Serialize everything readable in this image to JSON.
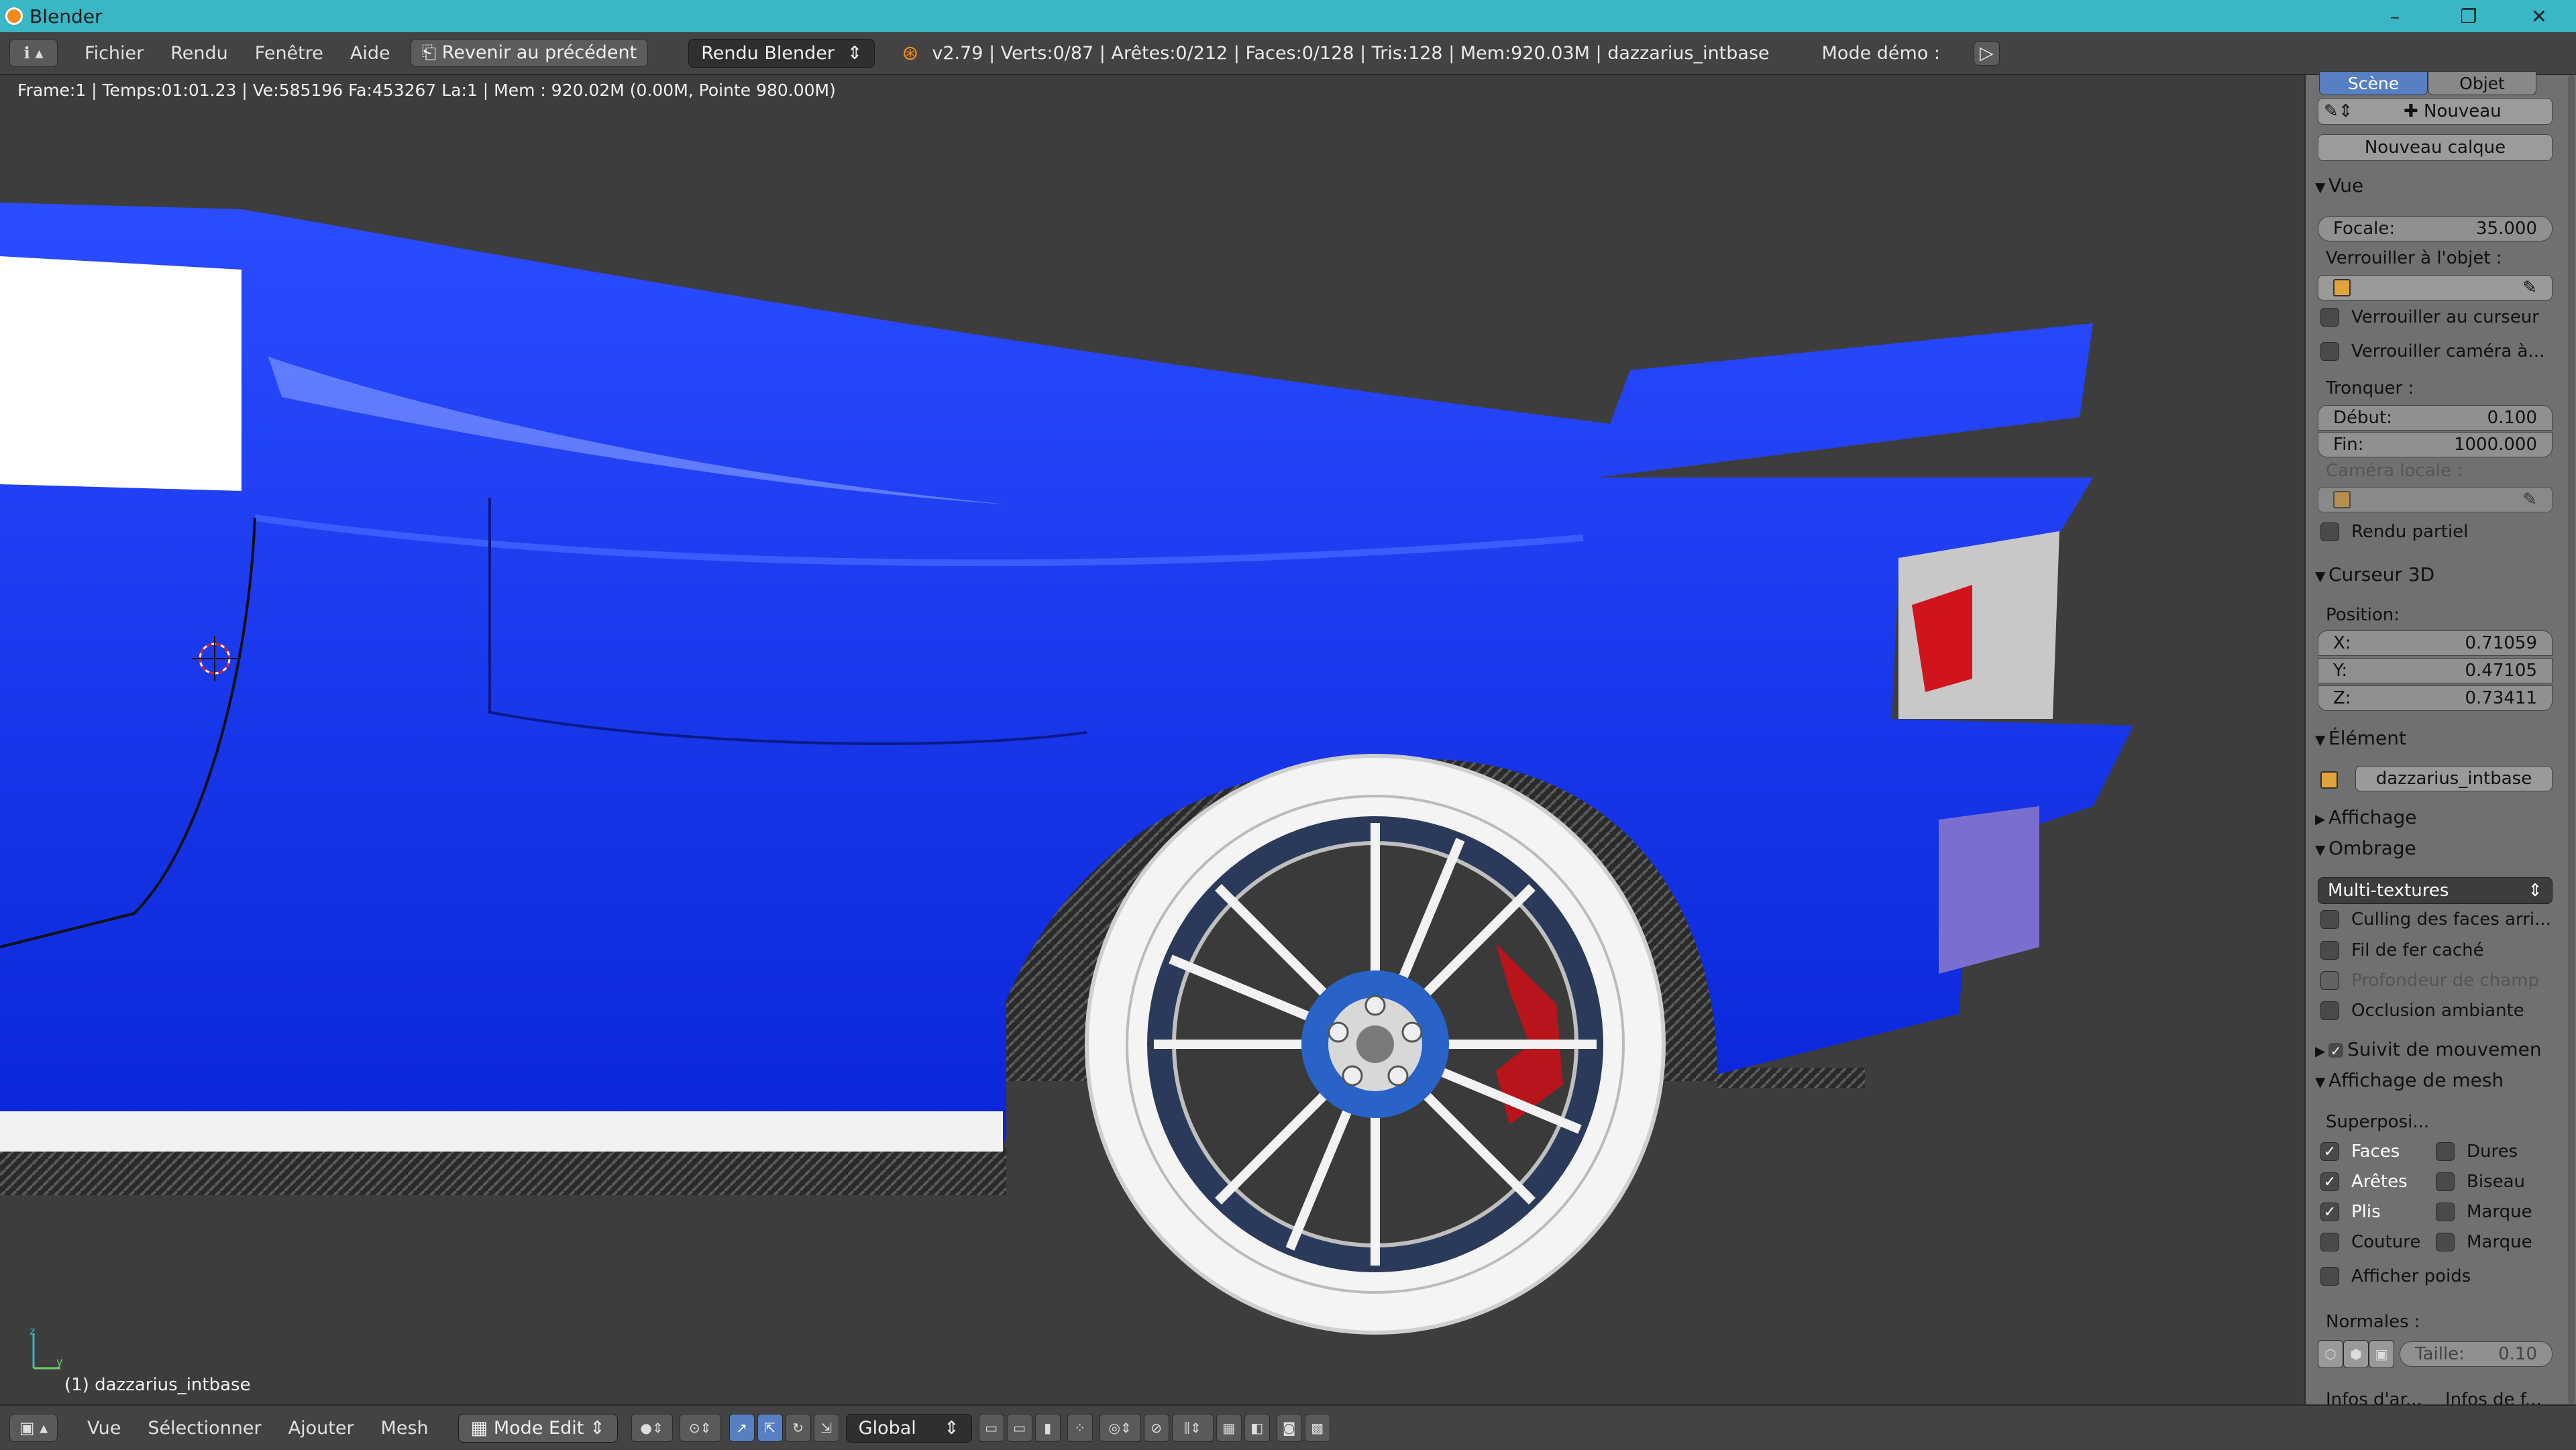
{
  "window": {
    "title": "Blender",
    "minimize": "–",
    "maximize": "❐",
    "close": "✕"
  },
  "topbar": {
    "editor_icon": "ℹ",
    "menus": [
      "Fichier",
      "Rendu",
      "Fenêtre",
      "Aide"
    ],
    "revert_button": "Revenir au précédent",
    "engine": "Rendu Blender",
    "stats": "v2.79 | Verts:0/87 | Arêtes:0/212 | Faces:0/128 | Tris:128 | Mem:920.03M | dazzarius_intbase",
    "demo_mode": "Mode démo :",
    "play_icon": "▷"
  },
  "viewport": {
    "info": "Frame:1 | Temps:01:01.23 | Ve:585196 Fa:453267 La:1 | Mem  : 920.02M (0.00M, Pointe 980.00M)",
    "object_label": "(1) dazzarius_intbase",
    "axis_z": "z",
    "axis_y": "y",
    "colors": {
      "body": "#0b2ff2",
      "tire": "#f4f4f4",
      "rim": "#dcdcdc",
      "caliper": "#b8141c",
      "carbon": "#2c2c2c"
    }
  },
  "panel": {
    "tabs": [
      "Scène",
      "Objet"
    ],
    "new_label": "Nouveau",
    "new_layer": "Nouveau calque",
    "vue": {
      "title": "Vue",
      "focale_label": "Focale:",
      "focale_value": "35.000",
      "lock_object_label": "Verrouiller à l'objet  :",
      "lock_cursor": "Verrouiller au curseur",
      "lock_camera": "Verrouiller caméra à...",
      "clip_label": "Tronquer  :",
      "start_label": "Début:",
      "start_value": "0.100",
      "end_label": "Fin:",
      "end_value": "1000.000",
      "local_camera": "Caméra locale  :",
      "partial_render": "Rendu partiel"
    },
    "cursor": {
      "title": "Curseur 3D",
      "position_label": "Position:",
      "x_label": "X:",
      "x_value": "0.71059",
      "y_label": "Y:",
      "y_value": "0.47105",
      "z_label": "Z:",
      "z_value": "0.73411"
    },
    "item": {
      "title": "Élément",
      "name": "dazzarius_intbase"
    },
    "display": {
      "title": "Affichage"
    },
    "shading": {
      "title": "Ombrage",
      "mode": "Multi-textures",
      "backface": "Culling des faces arri...",
      "hidden_wire": "Fil de fer caché",
      "dof": "Profondeur de champ",
      "ao": "Occlusion ambiante"
    },
    "motion_tracking": "Suivit de mouvemen",
    "mesh_display": {
      "title": "Affichage de mesh",
      "overlays": "Superposi...",
      "faces": "Faces",
      "edges": "Arêtes",
      "creases": "Plis",
      "seams": "Couture",
      "sharp": "Dures",
      "bevel": "Biseau",
      "mark1": "Marque",
      "mark2": "Marque",
      "weights": "Afficher poids",
      "normals": "Normales  :",
      "size_label": "Taille:",
      "size_value": "0.10",
      "info_arr": "Infos d'ar...",
      "info_face": "Infos de f..."
    }
  },
  "bottombar": {
    "menus": [
      "Vue",
      "Sélectionner",
      "Ajouter",
      "Mesh"
    ],
    "mode": "Mode Edit",
    "orientation": "Global"
  }
}
